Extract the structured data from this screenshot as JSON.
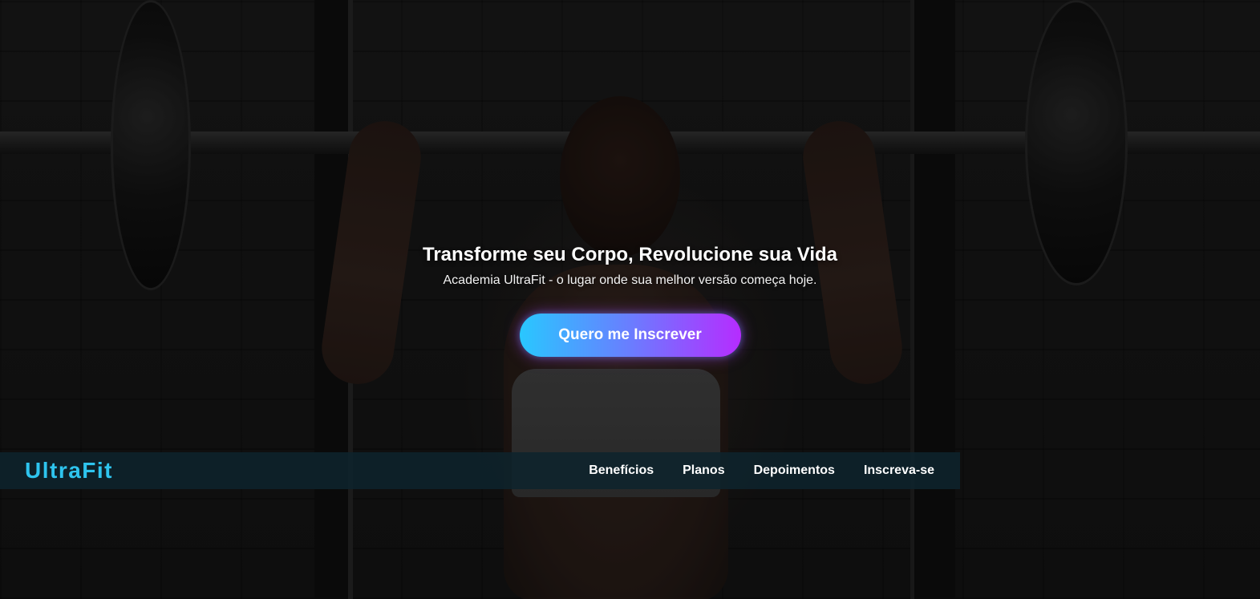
{
  "hero": {
    "title": "Transforme seu Corpo, Revolucione sua Vida",
    "subtitle": "Academia UltraFit - o lugar onde sua melhor versão começa hoje.",
    "cta_label": "Quero me Inscrever"
  },
  "navbar": {
    "brand": "UltraFit",
    "links": [
      {
        "label": "Benefícios"
      },
      {
        "label": "Planos"
      },
      {
        "label": "Depoimentos"
      },
      {
        "label": "Inscreva-se"
      }
    ]
  },
  "colors": {
    "brand": "#2ec4ee",
    "navbar_bg": "#0e232c",
    "cta_gradient_start": "#29c7ff",
    "cta_gradient_end": "#b62cff",
    "text": "#ffffff"
  }
}
